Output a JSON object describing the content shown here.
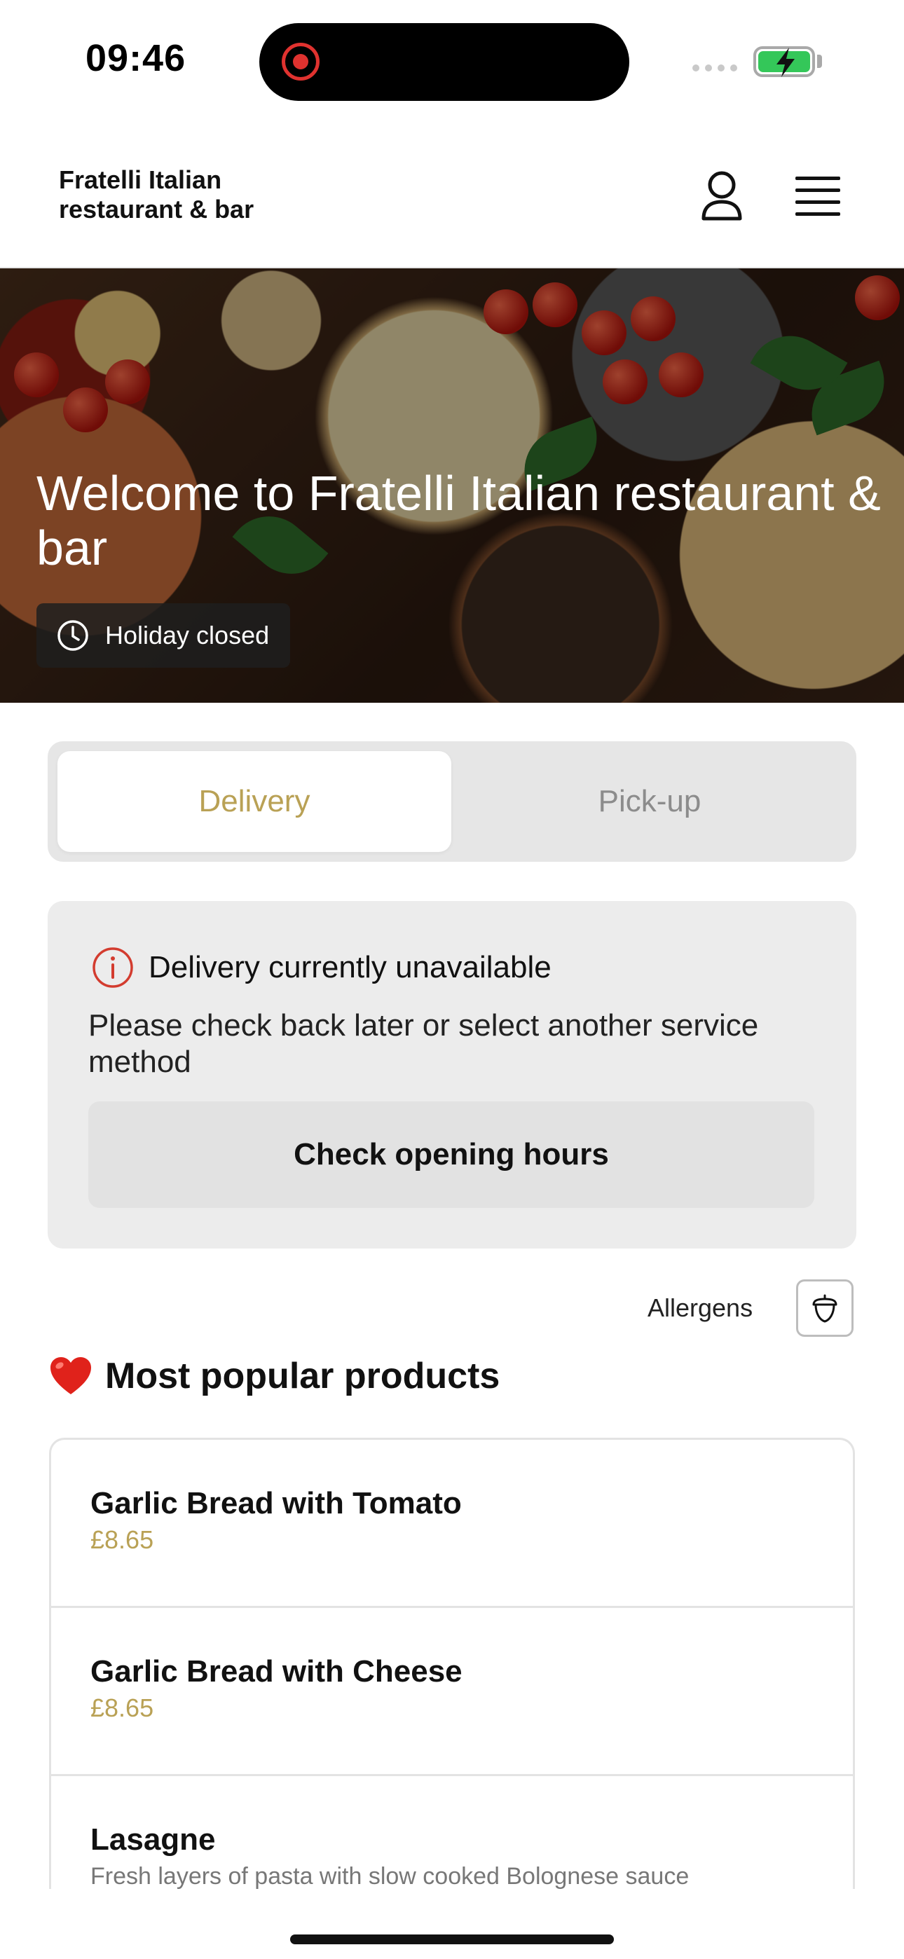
{
  "status_bar": {
    "time": "09:46",
    "recording_icon": "screen-recording-icon",
    "signal_icon": "cellular-signal-icon",
    "battery_icon": "battery-charging-icon",
    "battery_color": "#34c759"
  },
  "header": {
    "brand": "Fratelli Italian restaurant & bar",
    "account_icon": "user-icon",
    "menu_icon": "hamburger-menu-icon"
  },
  "hero": {
    "title": "Welcome to Fratelli Italian restaurant & bar",
    "hours_status": "Holiday closed",
    "hours_icon": "clock-icon"
  },
  "service": {
    "tabs": [
      {
        "label": "Delivery",
        "selected": true
      },
      {
        "label": "Pick-up",
        "selected": false
      }
    ],
    "accent_color": "#b9a155"
  },
  "notice": {
    "icon": "info-icon",
    "title": "Delivery currently unavailable",
    "message": "Please check back later or select another service method",
    "button_label": "Check opening hours",
    "icon_color": "#d33c2f"
  },
  "allergens": {
    "label": "Allergens",
    "icon": "acorn-icon"
  },
  "popular": {
    "icon": "heart-icon",
    "title": "Most popular products",
    "items": [
      {
        "name": "Garlic Bread with Tomato",
        "price": "£8.65"
      },
      {
        "name": "Garlic Bread with Cheese",
        "price": "£8.65"
      },
      {
        "name": "Lasagne",
        "description": "Fresh layers of pasta with slow cooked Bolognese sauce"
      }
    ]
  }
}
